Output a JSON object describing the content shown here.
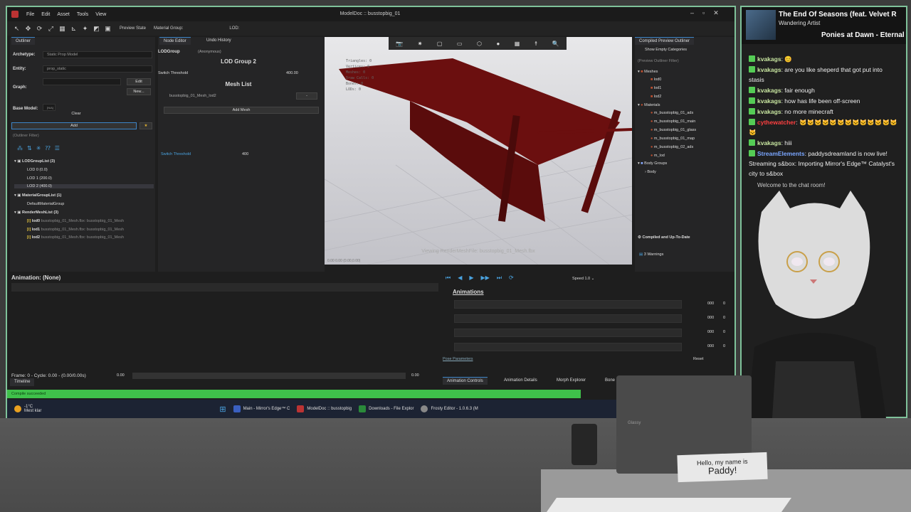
{
  "app": {
    "window_title": "ModelDoc :: busstopbig_01",
    "menus": [
      "File",
      "Edit",
      "Asset",
      "Tools",
      "View"
    ],
    "toolbar": {
      "preview_state": "Preview State",
      "material_group": "Material Group:",
      "lod": "LOD:"
    }
  },
  "outliner": {
    "tab": "Outliner",
    "archetype_label": "Archetype:",
    "archetype_value": "Static Prop Model",
    "entity_label": "Entity:",
    "entity_value": "prop_static",
    "graph_label": "Graph:",
    "edit_btn": "Edit",
    "new_btn": "New...",
    "base_model_label": "Base Model:",
    "base_model_value": "[N/A]",
    "clear_btn": "Clear",
    "add_btn": "Add",
    "filter_placeholder": "(Outliner Filter)",
    "tree": {
      "lodgroup": "LODGroupList (3)",
      "lods": [
        "LOD 0 (0.0)",
        "LOD 1 (200.0)",
        "LOD 2 (400.0)"
      ],
      "materialgroup": "MaterialGroupList (1)",
      "defaultmaterial": "DefaultMaterialGroup",
      "rendermesh": "RenderMeshList (3)",
      "meshes": [
        {
          "name": "lod0",
          "file": "busstopbig_01_Mesh.fbx: busstopbig_01_Mesh"
        },
        {
          "name": "lod1",
          "file": "busstopbig_01_Mesh.fbx: busstopbig_01_Mesh"
        },
        {
          "name": "lod2",
          "file": "busstopbig_01_Mesh.fbx: busstopbig_01_Mesh"
        }
      ]
    }
  },
  "node_editor": {
    "tabs": [
      "Node Editor",
      "Undo History"
    ],
    "type": "LODGroup",
    "anon": "(Anonymous)",
    "title": "LOD Group 2",
    "switch_label": "Switch Threshold",
    "switch_value": "400.00",
    "mesh_list": "Mesh List",
    "mesh_item": "busstopbig_01_Mesh_lod2",
    "mesh_dash": "-",
    "add_mesh": "Add Mesh",
    "switch_label2": "Switch Threshold",
    "switch_value2": "400"
  },
  "viewport": {
    "stats": [
      "Triangles: 0",
      "Vertices: 0",
      "Meshes: 0",
      "Draw Calls: 0",
      "Bones: 0",
      "LODs: 0"
    ],
    "caption": "Viewing RenderMeshFile: busstopbig_01_Mesh.fbx",
    "coords": "0.00 0.00 (0.00,0.00)"
  },
  "compiled": {
    "tab": "Compiled Preview Outliner",
    "show_empty": "Show Empty Categories",
    "filter": "(Preview Outliner Filter)",
    "meshes_label": "Meshes",
    "meshes": [
      "lod0",
      "lod1",
      "lod2"
    ],
    "materials_label": "Materials",
    "materials": [
      "m_busstopbig_01_ads",
      "m_busstopbig_01_main",
      "m_busstopbig_01_glass",
      "m_busstopbig_01_map",
      "m_busstopbig_02_ads",
      "m_lod"
    ],
    "body_groups": "Body Groups",
    "body": "Body",
    "status": "Compiled and Up-To-Date",
    "warnings": "3 Warnings"
  },
  "animation": {
    "title": "Animation: (None)",
    "frame": "Frame: 0 - Cycle: 0.00 - (0.00/0.00s)",
    "frame_start": "0.00",
    "frame_end": "0.00",
    "timeline_tab": "Timeline"
  },
  "anim_controls": {
    "speed_label": "Speed",
    "speed_value": "1.0",
    "animations": "Animations",
    "rows": [
      {
        "val": "000",
        "n": "0"
      },
      {
        "val": "000",
        "n": "0"
      },
      {
        "val": "000",
        "n": "0"
      },
      {
        "val": "000",
        "n": "0"
      }
    ],
    "pose_params": "Pose Parameters",
    "reset": "Reset",
    "tabs": [
      "Animation Controls",
      "Animation Details",
      "Morph Explorer",
      "Bone"
    ]
  },
  "status": {
    "compile": "Compile succeeded"
  },
  "taskbar": {
    "weather_temp": "-1°C",
    "weather_desc": "Mest klar",
    "items": [
      "Main - Mirror's Edge™ C",
      "ModelDoc :: busstopbig",
      "Downloads - File Explor",
      "Frosty Editor - 1.0.6.3 (M"
    ]
  },
  "now_playing": {
    "title": "The End Of Seasons (feat. Velvet R",
    "artist": "Wandering Artist",
    "next": "Ponies at Dawn - Eternal"
  },
  "chat": [
    {
      "user": "kvakags",
      "text": "😊"
    },
    {
      "user": "kvakags",
      "text": "are you like sheperd that got put into stasis"
    },
    {
      "user": "kvakags",
      "text": "fair enough"
    },
    {
      "user": "kvakags",
      "text": "how has life been off-screen"
    },
    {
      "user": "kvakags",
      "text": "no more minecraft"
    },
    {
      "user": "cythewatcher",
      "text": "🐱🐱🐱🐱🐱🐱🐱🐱🐱🐱🐱🐱🐱🐱"
    },
    {
      "user": "kvakags",
      "text": "hiii"
    },
    {
      "user": "StreamElements",
      "text": "paddysdreamland is now live! Streaming s&box: Importing Mirror's Edge™ Catalyst's city to s&box"
    }
  ],
  "chat_welcome": "Welcome to the chat room!",
  "nametag": {
    "line1": "Hello, my name is",
    "line2": "Paddy!"
  },
  "laptop_label": "Glassy"
}
